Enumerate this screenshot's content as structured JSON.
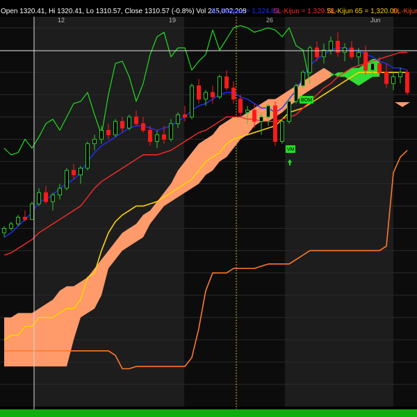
{
  "header": {
    "ohlc": "Open 1320.41, Hi 1320.41, Lo 1310.57, Close 1310.57 (-0.8%) Vol 245,002,208",
    "indicators": [
      {
        "label": "SL-Tenkan = 1,324.83,",
        "color": "#1f2fff"
      },
      {
        "label": "SL-Kijun = 1,329.78,",
        "color": "#ff2a2a"
      },
      {
        "label": "SL-Kijun 65 = 1,320.00,",
        "color": "#ffd400"
      },
      {
        "label": "SL-Kijun",
        "color": "#ff4a1a"
      }
    ]
  },
  "chart_data": {
    "type": "candlestick",
    "x_ticks": [
      {
        "label": "12",
        "bar": 8
      },
      {
        "label": "19",
        "bar": 24
      },
      {
        "label": "26",
        "bar": 38
      },
      {
        "label": "Jun",
        "bar": 53
      }
    ],
    "signals": [
      {
        "label": "BOM",
        "bar": 40
      },
      {
        "label": "VM",
        "bar": 38
      }
    ],
    "colors": {
      "up": "#2ecc2e",
      "down": "#ff1a1a",
      "tenkan": "#1f2fff",
      "kijun": "#ff2a2a",
      "kijun65": "#ffd400",
      "kijun_long": "#ff7a2a",
      "chikou": "#21e021",
      "cloud_bull": "#33dd33",
      "cloud_bear": "#ff9a6a",
      "bottom_bar": "#0fae0f"
    },
    "candles": [
      [
        1248,
        1251,
        1246,
        1250
      ],
      [
        1250,
        1253,
        1249,
        1252
      ],
      [
        1252,
        1256,
        1251,
        1255
      ],
      [
        1255,
        1258,
        1253,
        1254
      ],
      [
        1254,
        1262,
        1254,
        1261
      ],
      [
        1261,
        1268,
        1260,
        1266
      ],
      [
        1266,
        1269,
        1261,
        1262
      ],
      [
        1262,
        1266,
        1258,
        1265
      ],
      [
        1265,
        1270,
        1263,
        1268
      ],
      [
        1268,
        1277,
        1267,
        1276
      ],
      [
        1276,
        1279,
        1272,
        1274
      ],
      [
        1274,
        1278,
        1270,
        1277
      ],
      [
        1277,
        1289,
        1276,
        1288
      ],
      [
        1288,
        1292,
        1285,
        1290
      ],
      [
        1290,
        1296,
        1288,
        1294
      ],
      [
        1294,
        1297,
        1290,
        1292
      ],
      [
        1292,
        1299,
        1291,
        1298
      ],
      [
        1298,
        1300,
        1293,
        1295
      ],
      [
        1295,
        1301,
        1294,
        1300
      ],
      [
        1300,
        1303,
        1296,
        1297
      ],
      [
        1297,
        1300,
        1293,
        1294
      ],
      [
        1294,
        1296,
        1287,
        1289
      ],
      [
        1289,
        1294,
        1286,
        1292
      ],
      [
        1292,
        1296,
        1288,
        1290
      ],
      [
        1290,
        1299,
        1289,
        1297
      ],
      [
        1297,
        1302,
        1295,
        1301
      ],
      [
        1301,
        1305,
        1298,
        1300
      ],
      [
        1300,
        1315,
        1299,
        1314
      ],
      [
        1314,
        1317,
        1306,
        1308
      ],
      [
        1308,
        1312,
        1305,
        1311
      ],
      [
        1311,
        1314,
        1306,
        1309
      ],
      [
        1309,
        1319,
        1308,
        1318
      ],
      [
        1318,
        1321,
        1312,
        1313
      ],
      [
        1313,
        1316,
        1306,
        1308
      ],
      [
        1308,
        1310,
        1300,
        1302
      ],
      [
        1302,
        1305,
        1297,
        1303
      ],
      [
        1303,
        1306,
        1295,
        1298
      ],
      [
        1298,
        1302,
        1292,
        1300
      ],
      [
        1300,
        1306,
        1296,
        1305
      ],
      [
        1305,
        1307,
        1287,
        1289
      ],
      [
        1289,
        1299,
        1288,
        1298
      ],
      [
        1298,
        1308,
        1297,
        1307
      ],
      [
        1307,
        1315,
        1306,
        1314
      ],
      [
        1314,
        1321,
        1313,
        1320
      ],
      [
        1320,
        1332,
        1319,
        1331
      ],
      [
        1331,
        1334,
        1325,
        1327
      ],
      [
        1327,
        1333,
        1324,
        1330
      ],
      [
        1330,
        1336,
        1328,
        1334
      ],
      [
        1334,
        1338,
        1327,
        1329
      ],
      [
        1329,
        1333,
        1325,
        1331
      ],
      [
        1331,
        1334,
        1326,
        1327
      ],
      [
        1327,
        1331,
        1323,
        1329
      ],
      [
        1329,
        1332,
        1319,
        1321
      ],
      [
        1321,
        1326,
        1318,
        1324
      ],
      [
        1324,
        1327,
        1318,
        1320
      ],
      [
        1320,
        1324,
        1313,
        1315
      ],
      [
        1315,
        1320,
        1312,
        1318
      ],
      [
        1318,
        1322,
        1315,
        1320
      ],
      [
        1320,
        1321,
        1310,
        1311
      ]
    ],
    "tenkan": [
      1246,
      1248,
      1251,
      1254,
      1257,
      1262,
      1263,
      1265,
      1268,
      1270,
      1272,
      1275,
      1280,
      1284,
      1287,
      1289,
      1291,
      1293,
      1295,
      1296,
      1296,
      1295,
      1294,
      1295,
      1296,
      1298,
      1300,
      1303,
      1305,
      1306,
      1308,
      1310,
      1311,
      1311,
      1309,
      1308,
      1306,
      1304,
      1304,
      1302,
      1304,
      1308,
      1312,
      1318,
      1323,
      1326,
      1328,
      1330,
      1331,
      1331,
      1330,
      1330,
      1328,
      1327,
      1325,
      1324,
      1322,
      1322,
      1321
    ],
    "kijun": [
      1238,
      1239,
      1241,
      1243,
      1245,
      1248,
      1250,
      1252,
      1254,
      1256,
      1258,
      1260,
      1264,
      1268,
      1271,
      1273,
      1275,
      1277,
      1279,
      1281,
      1283,
      1283,
      1283,
      1284,
      1285,
      1287,
      1289,
      1291,
      1293,
      1294,
      1296,
      1298,
      1300,
      1300,
      1300,
      1299,
      1299,
      1298,
      1298,
      1298,
      1299,
      1300,
      1301,
      1304,
      1307,
      1310,
      1313,
      1315,
      1318,
      1320,
      1322,
      1323,
      1324,
      1325,
      1326,
      1327,
      1328,
      1329,
      1329
    ],
    "kijun65": [
      1200,
      1202,
      1202,
      1206,
      1206,
      1210,
      1210,
      1210,
      1212,
      1214,
      1214,
      1218,
      1228,
      1230,
      1240,
      1248,
      1253,
      1256,
      1258,
      1260,
      1260,
      1261,
      1262,
      1264,
      1266,
      1268,
      1270,
      1272,
      1276,
      1280,
      1282,
      1284,
      1288,
      1290,
      1291,
      1292,
      1293,
      1294,
      1295,
      1296,
      1299,
      1302,
      1303,
      1304,
      1306,
      1308,
      1310,
      1312,
      1314,
      1316,
      1318,
      1320,
      1320,
      1320,
      1320,
      1320,
      1320,
      1320,
      1320
    ],
    "kijun_long": [
      1195,
      1195,
      1195,
      1195,
      1195,
      1195,
      1195,
      1195,
      1195,
      1195,
      1195,
      1195,
      1195,
      1195,
      1195,
      1195,
      1193,
      1187,
      1187,
      1188,
      1188,
      1188,
      1188,
      1188,
      1188,
      1188,
      1188,
      1192,
      1205,
      1222,
      1230,
      1230,
      1230,
      1232,
      1232,
      1232,
      1232,
      1233,
      1234,
      1234,
      1234,
      1234,
      1236,
      1238,
      1240,
      1240,
      1240,
      1240,
      1240,
      1240,
      1240,
      1240,
      1240,
      1240,
      1240,
      1242,
      1275,
      1282,
      1285
    ],
    "chikou": [
      1286,
      1283,
      1284,
      1290,
      1286,
      1291,
      1297,
      1299,
      1294,
      1300,
      1306,
      1307,
      1311,
      1301,
      1292,
      1310,
      1324,
      1325,
      1318,
      1307,
      1315,
      1328,
      1336,
      1338,
      1327,
      1331,
      1331,
      1321,
      1325,
      1328,
      1339,
      1330,
      1335,
      1340,
      1341,
      1340,
      1338,
      1339,
      1340,
      1339,
      1336,
      1340,
      1332,
      1330,
      1315
    ],
    "span_a": [
      1188,
      1188,
      1188,
      1188,
      1188,
      1188,
      1188,
      1188,
      1188,
      1188,
      1200,
      1210,
      1212,
      1214,
      1220,
      1232,
      1236,
      1240,
      1242,
      1244,
      1246,
      1252,
      1256,
      1260,
      1262,
      1264,
      1266,
      1268,
      1270,
      1274,
      1276,
      1280,
      1282,
      1286,
      1290,
      1292,
      1296,
      1298,
      1298,
      1300,
      1302,
      1305,
      1307,
      1310,
      1312,
      1314,
      1316,
      1318,
      1320,
      1320,
      1322,
      1322,
      1324,
      1326,
      1326
    ],
    "span_b": [
      1210,
      1210,
      1212,
      1212,
      1212,
      1214,
      1216,
      1218,
      1222,
      1224,
      1224,
      1226,
      1228,
      1232,
      1236,
      1240,
      1244,
      1248,
      1250,
      1252,
      1256,
      1258,
      1262,
      1266,
      1270,
      1276,
      1280,
      1284,
      1288,
      1290,
      1292,
      1296,
      1298,
      1300,
      1300,
      1302,
      1304,
      1306,
      1308,
      1308,
      1310,
      1312,
      1314,
      1316,
      1318,
      1320,
      1322,
      1320,
      1318,
      1318,
      1316,
      1314,
      1316,
      1318,
      1318
    ],
    "ylim": [
      1170,
      1345
    ]
  }
}
